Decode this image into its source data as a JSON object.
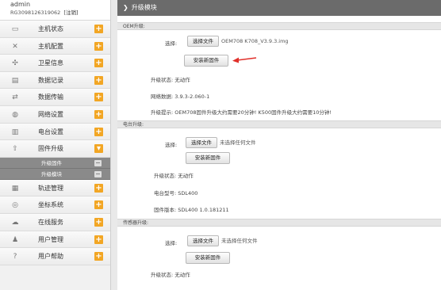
{
  "user": {
    "name": "admin",
    "id": "RG3098126319062",
    "logout": "[注销]"
  },
  "menu": [
    {
      "label": "主机状态",
      "icon": "monitor-icon"
    },
    {
      "label": "主机配置",
      "icon": "tools-icon"
    },
    {
      "label": "卫星信息",
      "icon": "satellite-icon"
    },
    {
      "label": "数据记录",
      "icon": "record-icon"
    },
    {
      "label": "数据传输",
      "icon": "transfer-icon"
    },
    {
      "label": "网络设置",
      "icon": "globe-icon"
    },
    {
      "label": "电台设置",
      "icon": "radio-icon"
    },
    {
      "label": "固件升级",
      "icon": "upload-icon"
    }
  ],
  "submenu": [
    {
      "label": "升级固件"
    },
    {
      "label": "升级模块"
    }
  ],
  "menu2": [
    {
      "label": "轨迹管理",
      "icon": "track-icon"
    },
    {
      "label": "坐标系统",
      "icon": "coordinate-icon"
    },
    {
      "label": "在线服务",
      "icon": "cloud-icon"
    },
    {
      "label": "用户管理",
      "icon": "user-icon"
    },
    {
      "label": "用户帮助",
      "icon": "help-icon"
    }
  ],
  "main": {
    "title": "升级模块",
    "sections": {
      "oem": {
        "head": "OEM升级:",
        "file_label": "选择:",
        "choose_btn": "选择文件",
        "file_name": "OEM708 K708_V3.9.3.img",
        "install_btn": "安装新固件",
        "status": "升级状态: 无动作",
        "board_version": "网络数据: 3.9.3-2.060-1",
        "tip": "升级提示: OEM708固件升级大约需要20分钟! K500固件升级大约需要10分钟!"
      },
      "radio": {
        "head": "电台升级:",
        "file_label": "选择:",
        "choose_btn": "选择文件",
        "file_name": "未选择任何文件",
        "install_btn": "安装新固件",
        "status": "升级状态: 无动作",
        "model": "电台型号: SDL400",
        "fw": "固件版本: SDL400 1.0.181211"
      },
      "sensor": {
        "head": "传感器升级:",
        "file_label": "选择:",
        "choose_btn": "选择文件",
        "file_name": "未选择任何文件",
        "install_btn": "安装新固件",
        "status": "升级状态: 无动作"
      }
    }
  },
  "colors": {
    "accent_orange": "#f2a624",
    "title_bar": "#6b6b6b",
    "arrow": "#e0302a"
  }
}
